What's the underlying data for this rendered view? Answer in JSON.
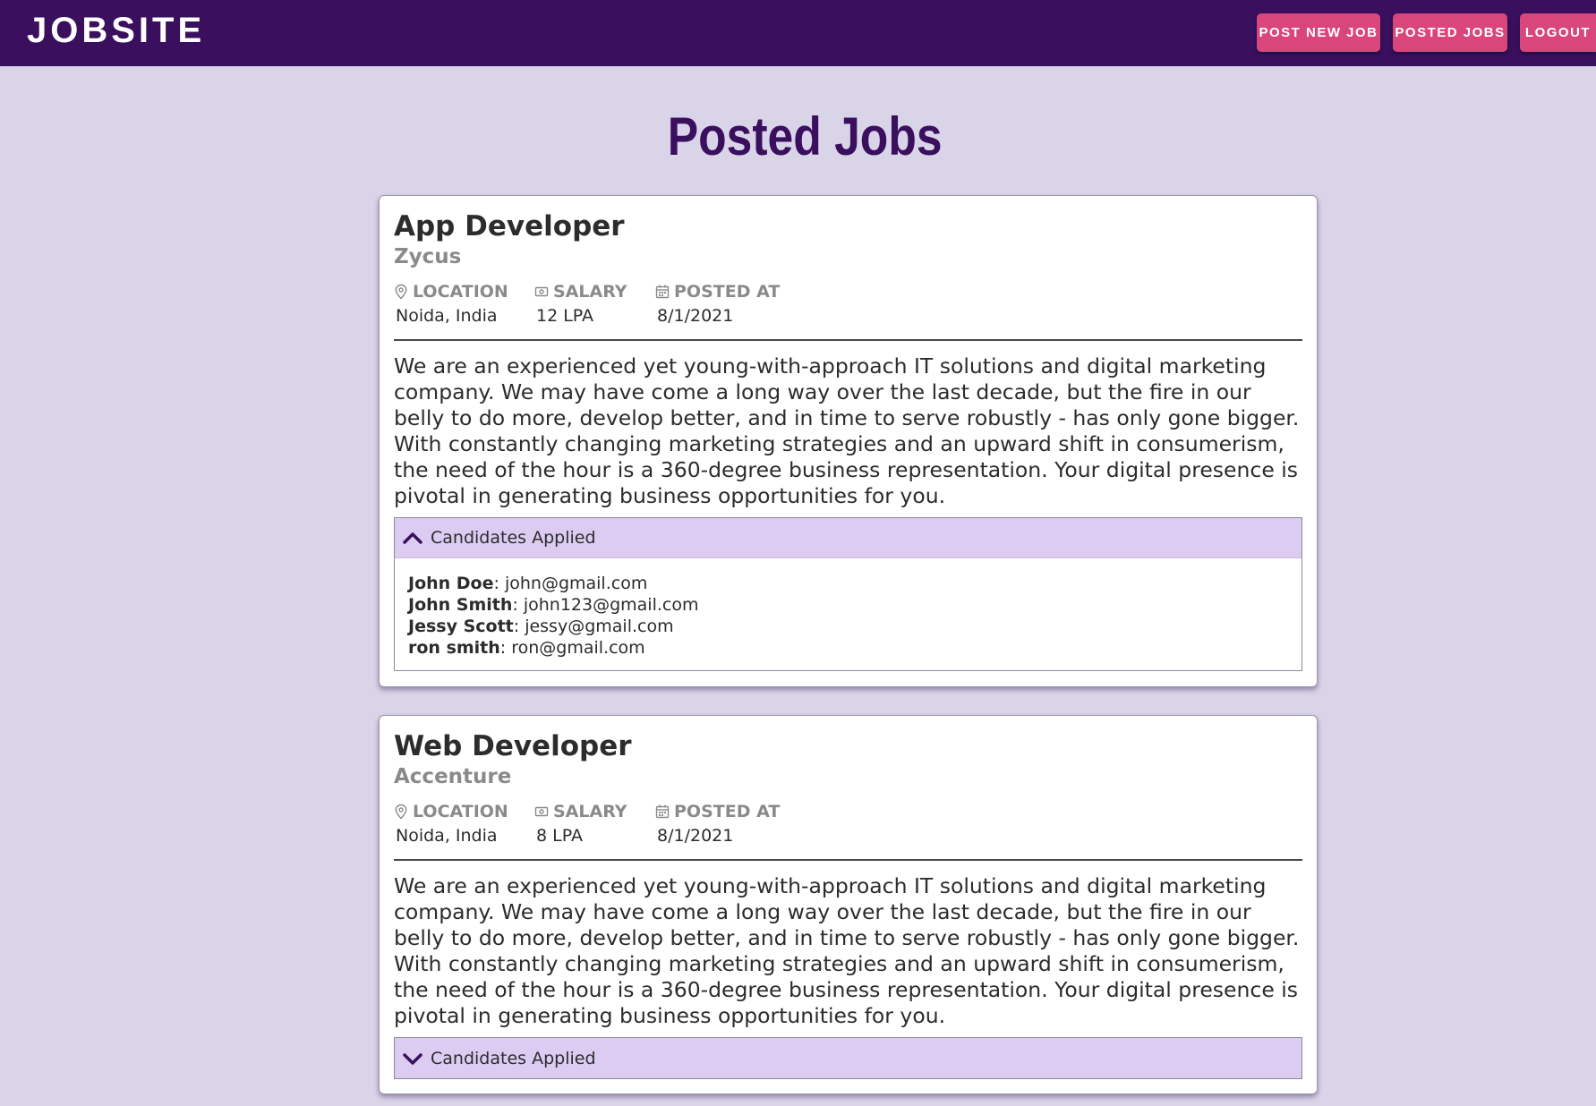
{
  "navbar": {
    "brand": "JOBSITE",
    "buttons": {
      "post_new_job": "POST NEW JOB",
      "posted_jobs": "POSTED JOBS",
      "logout": "LOGOUT"
    }
  },
  "page": {
    "title": "Posted Jobs"
  },
  "labels": {
    "location": "LOCATION",
    "salary": "SALARY",
    "posted_at": "POSTED AT",
    "candidates_applied": "Candidates Applied"
  },
  "jobs": [
    {
      "title": "App Developer",
      "company": "Zycus",
      "location": "Noida, India",
      "salary": "12 LPA",
      "posted_at": "8/1/2021",
      "description": "We are an experienced yet young-with-approach IT solutions and digital marketing company. We may have come a long way over the last decade, but the fire in our belly to do more, develop better, and in time to serve robustly - has only gone bigger. With constantly changing marketing strategies and an upward shift in consumerism, the need of the hour is a 360-degree business representation. Your digital presence is pivotal in generating business opportunities for you.",
      "candidates_expanded": true,
      "candidates": [
        {
          "name": "John Doe",
          "email": ": john@gmail.com"
        },
        {
          "name": "John Smith",
          "email": ": john123@gmail.com"
        },
        {
          "name": "Jessy Scott",
          "email": ": jessy@gmail.com"
        },
        {
          "name": "ron smith",
          "email": ": ron@gmail.com"
        }
      ]
    },
    {
      "title": "Web Developer",
      "company": "Accenture",
      "location": "Noida, India",
      "salary": "8 LPA",
      "posted_at": "8/1/2021",
      "description": "We are an experienced yet young-with-approach IT solutions and digital marketing company. We may have come a long way over the last decade, but the fire in our belly to do more, develop better, and in time to serve robustly - has only gone bigger. With constantly changing marketing strategies and an upward shift in consumerism, the need of the hour is a 360-degree business representation. Your digital presence is pivotal in generating business opportunities for you.",
      "candidates_expanded": false
    }
  ],
  "icons": {
    "location": "location-pin-icon",
    "salary": "money-icon",
    "posted_at": "calendar-icon",
    "expanded": "chevron-up-icon",
    "collapsed": "chevron-down-icon"
  },
  "colors": {
    "navbar_bg": "#3a0f5e",
    "page_bg": "#dad4e9",
    "button_bg": "#d9467a",
    "title_color": "#3a0f5e",
    "accordion_header_bg": "#dcccf2"
  }
}
